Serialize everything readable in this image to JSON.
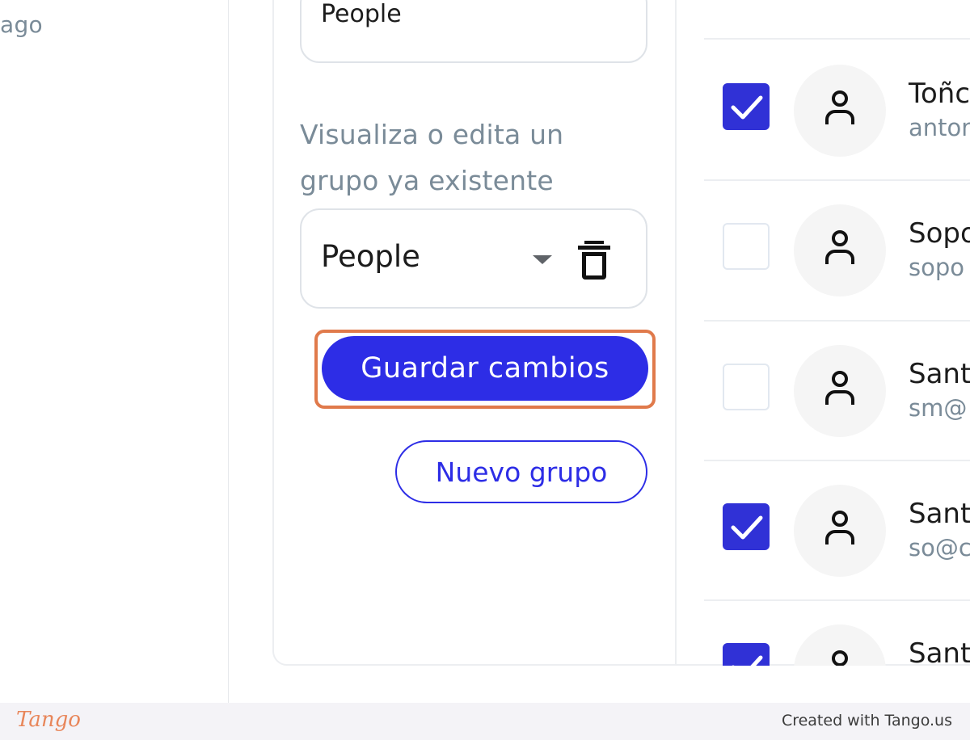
{
  "sidebar": {
    "text": "ago"
  },
  "group_form": {
    "name_value": "People",
    "helper_text": "Visualiza o edita un grupo ya existente",
    "selected_group": "People",
    "save_label": "Guardar cambios",
    "new_group_label": "Nuevo grupo"
  },
  "users": [
    {
      "name": "Toñc",
      "email": "anton",
      "checked": true
    },
    {
      "name": "Sopo",
      "email": "sopo",
      "checked": false
    },
    {
      "name": "Sant",
      "email": "sm@",
      "checked": false
    },
    {
      "name": "Sant",
      "email": "so@c",
      "checked": true
    },
    {
      "name": "Sant",
      "email": "",
      "checked": true
    }
  ],
  "footer": {
    "logo": "Tango",
    "credit": "Created with Tango.us"
  },
  "colors": {
    "primary": "#2d2de6",
    "highlight": "#e07a4b",
    "muted_text": "#7a8b98"
  },
  "icons": {
    "caret": "caret-down-icon",
    "trash": "trash-icon",
    "check": "check-icon",
    "avatar": "person-icon"
  }
}
